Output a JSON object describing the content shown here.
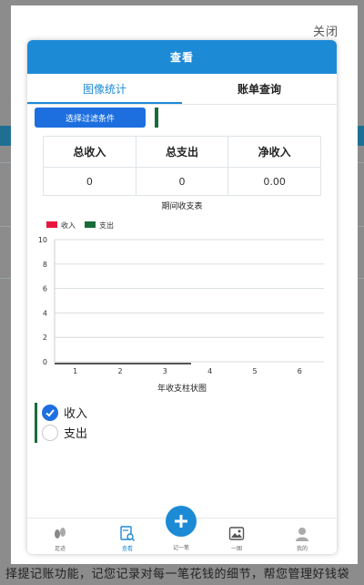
{
  "modal": {
    "close_label": "关闭"
  },
  "header": {
    "title": "查看"
  },
  "tabs": [
    {
      "label": "图像统计",
      "active": true
    },
    {
      "label": "账单查询",
      "active": false
    }
  ],
  "filter": {
    "button_label": "选择过滤条件"
  },
  "summary": {
    "headers": [
      "总收入",
      "总支出",
      "净收入"
    ],
    "values": [
      "0",
      "0",
      "0.00"
    ],
    "caption": "期间收支表"
  },
  "chart_data": {
    "type": "bar",
    "categories": [
      "1",
      "2",
      "3",
      "4",
      "5",
      "6"
    ],
    "series": [
      {
        "name": "收入",
        "values": [
          0,
          0,
          0,
          0,
          0,
          0
        ],
        "color": "#e8173f"
      },
      {
        "name": "支出",
        "values": [
          0,
          0,
          0,
          0,
          0,
          0
        ],
        "color": "#1a6b3c"
      }
    ],
    "yticks": [
      "0",
      "2",
      "4",
      "6",
      "8",
      "10"
    ],
    "ylim": [
      0,
      10
    ],
    "grid": true,
    "legend": "top-left",
    "title": "年收支柱状图"
  },
  "options": [
    {
      "label": "收入",
      "checked": true
    },
    {
      "label": "支出",
      "checked": false
    }
  ],
  "bottom_nav": {
    "items": [
      {
        "label": "足迹",
        "icon": "footprint-icon"
      },
      {
        "label": "查看",
        "icon": "search-doc-icon",
        "active": true
      },
      {
        "label": "记一笔",
        "icon": "plus-icon"
      },
      {
        "label": "一图",
        "icon": "picture-icon"
      },
      {
        "label": "我的",
        "icon": "user-icon"
      }
    ]
  },
  "background": {
    "text": "择提记账功能，记您记录对每一笔花钱的细节，帮您管理好钱袋"
  },
  "colors": {
    "accent": "#1d8ad6",
    "button": "#1d6fe0",
    "income": "#e8173f",
    "expense": "#1a6b3c"
  }
}
